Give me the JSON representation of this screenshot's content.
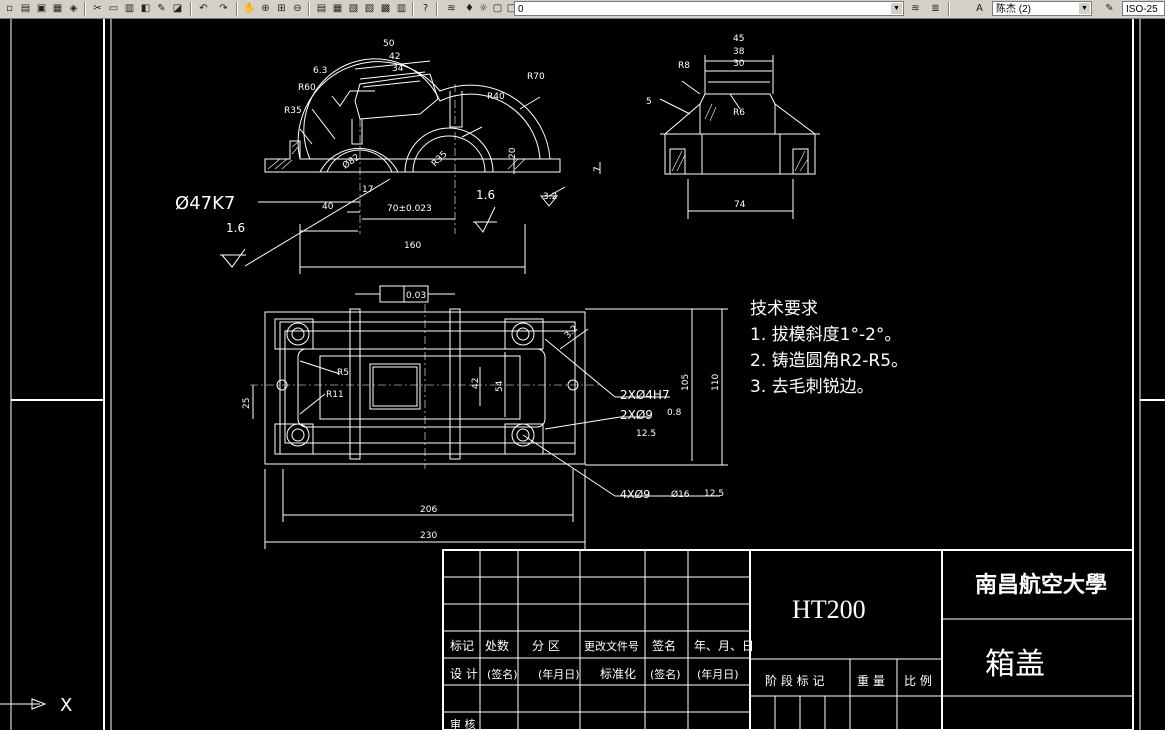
{
  "toolbar": {
    "layer_value": "0",
    "user_value": "陈杰 (2)",
    "style_value": "ISO-25",
    "icons": [
      "new-icon",
      "open-icon",
      "save-icon",
      "plot-icon",
      "cut-icon",
      "copy-icon",
      "paste-icon",
      "match-prop-icon",
      "brush-icon",
      "undo-icon",
      "redo-icon",
      "pan-icon",
      "zoom-realtime-icon",
      "zoom-window-icon",
      "zoom-previous-icon",
      "properties-icon",
      "design-center-icon",
      "tool-palette-icon",
      "sheet-set-icon",
      "markup-icon",
      "calculator-icon",
      "help-icon",
      "layer-manager-icon",
      "lightbulb-icon",
      "sun-icon",
      "lock-icon",
      "color-square-icon",
      "layer-previous-icon",
      "layer-state-icon",
      "text-style-icon",
      "dim-style-icon"
    ]
  },
  "front_view": {
    "dims": {
      "d50": "50",
      "d42": "42",
      "d34": "34",
      "surface_6_3": "6.3",
      "r60": "R60",
      "r35": "R35",
      "r70": "R70",
      "r40": "R40",
      "phi_large": "Ø82",
      "r35b": "R35",
      "d20": "20",
      "d7": "7",
      "d3_2": "3.2",
      "d17": "17",
      "d70": "70±0.023",
      "d40": "40",
      "d160": "160",
      "hole_fit": "Ø47K7",
      "surface_1_6a": "1.6",
      "surface_1_6b": "1.6"
    }
  },
  "side_view": {
    "dims": {
      "d45": "45",
      "d38": "38",
      "d30": "30",
      "r8": "R8",
      "d5": "5",
      "r6": "R6",
      "d74": "74"
    }
  },
  "top_view": {
    "dims": {
      "parallel_tol": "0.03",
      "r5": "R5",
      "r11": "R11",
      "d25": "25",
      "d42": "42",
      "d54": "54",
      "d105": "105",
      "d110": "110",
      "d206": "206",
      "d230": "230",
      "d3_2": "3.2",
      "callout_4h7": "2XØ4H7",
      "callout_0_8": "0.8",
      "callout_9": "2XØ9",
      "callout_12_5": "12.5",
      "callout_4x9": "4XØ9",
      "callout_16": "Ø16",
      "callout_12_5b": "12.5"
    }
  },
  "tech_requirements": {
    "title": "技术要求",
    "items": [
      "1. 拔模斜度1°-2°。",
      "2. 铸造圆角R2-R5。",
      "3. 去毛刺锐边。"
    ]
  },
  "title_block": {
    "material": "HT200",
    "school": "南昌航空大學",
    "part_name": "箱盖",
    "row_headers": [
      "标记",
      "处数",
      "分 区",
      "更改文件号",
      "签名",
      "年、月、日"
    ],
    "sign_row": [
      "设 计",
      "(签名)",
      "(年月日)",
      "标准化",
      "(签名)",
      "(年月日)"
    ],
    "stage_row": [
      "阶 段 标 记",
      "重 量",
      "比 例"
    ],
    "bottom_label": "审 核"
  },
  "ucs": {
    "x_label": "X"
  }
}
